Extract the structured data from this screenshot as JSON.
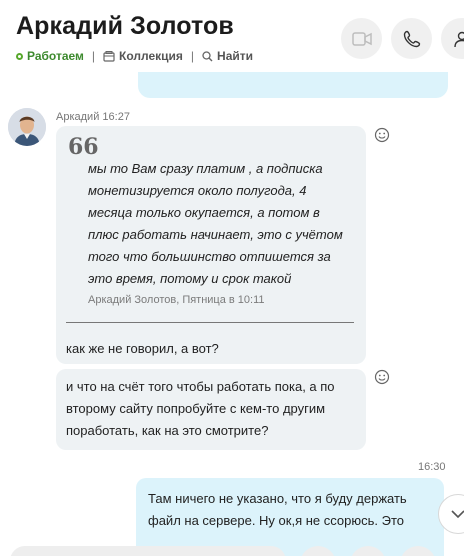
{
  "header": {
    "contact_name": "Аркадий Золотов",
    "status_label": "Работаем",
    "collection_label": "Коллекция",
    "find_label": "Найти",
    "separator": "|"
  },
  "messages": {
    "top_partial_text": "",
    "incoming_sender": "Аркадий",
    "incoming_time": "16:27",
    "quote_mark": "66",
    "quote_text": "мы то Вам сразу платим , а подписка монетизируется около полугода, 4 месяца только окупается, а потом в плюс работать начинает, это с учётом того что большинство отпишется за это время, потому и срок такой",
    "quote_author": "Аркадий Золотов, Пятница в 10:11",
    "reply_text": "как же не говорил, а вот?",
    "second_message_text": "и что на счёт того чтобы работать пока, а по второму сайту попробуйте с кем-то другим поработать, как на это смотрите?",
    "outgoing_time": "16:30",
    "outgoing_text": "Там ничего не указано, что я буду держать файл на сервере. Ну ок,я не ссорюсь.  Это"
  },
  "colors": {
    "status_green": "#3d8a2e",
    "outgoing_bubble": "#dcf3fb",
    "incoming_bubble": "#eef2f4"
  },
  "icons": {
    "video": "video-call-icon",
    "call": "phone-icon",
    "add_people": "add-person-icon",
    "react": "smiley-icon",
    "scroll": "chevron-down-icon"
  }
}
